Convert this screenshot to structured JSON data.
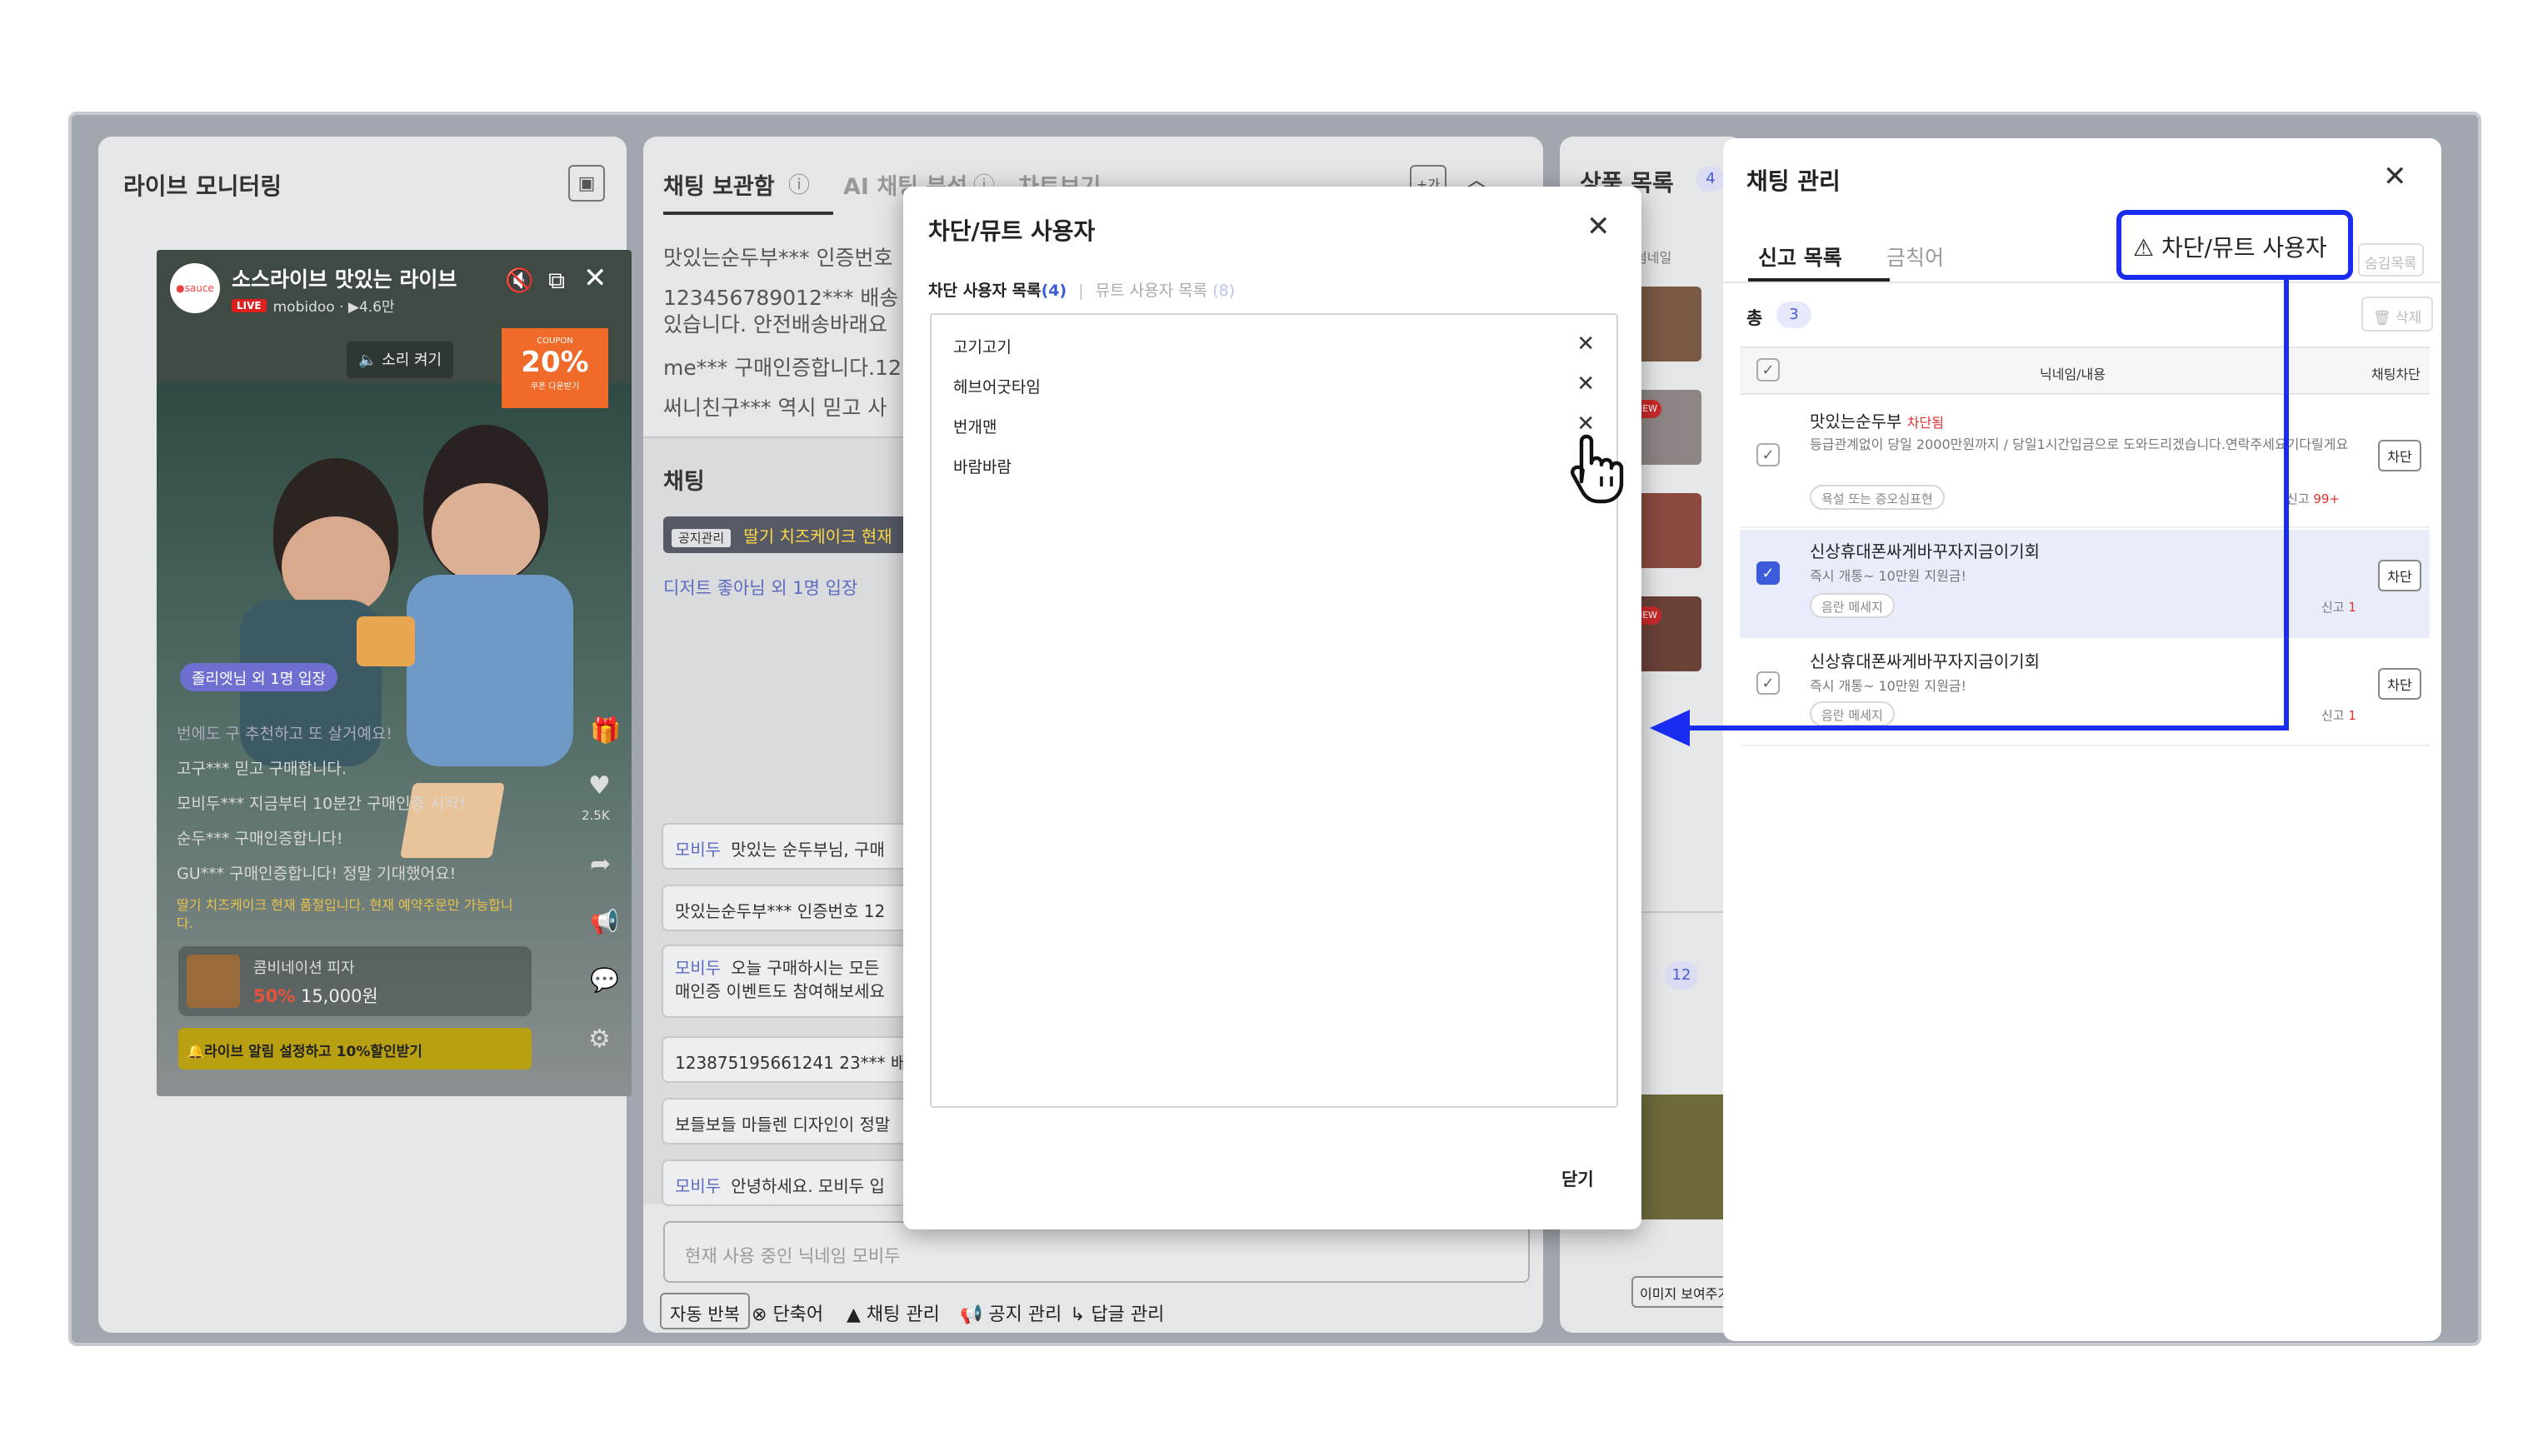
{
  "live_monitor": {
    "title": "라이브 모니터링",
    "stream_title": "소스라이브 맛있는 라이브",
    "live_badge": "LIVE",
    "channel_meta": "mobidoo · ▶4.6만",
    "sound_on_label": "소리 켜기",
    "coupon_top": "COUPON",
    "coupon_value": "20%",
    "coupon_sub": "쿠폰 다운받기",
    "entry_notice": "졸리엣님 외 1명 입장",
    "overlay_lines": [
      "번에도 구 추천하고 또 살거예요!",
      "고구*** 믿고 구매합니다.",
      "모비두*** 지금부터 10분간 구매인증 시작!",
      "순두*** 구매인증합니다!",
      "GU*** 구매인증합니다! 정말 기대했어요!"
    ],
    "notice_line": "딸기 치즈케이크 현재 품절입니다. 현재 예약주문만 가능합니다.",
    "product_name": "콤비네이션 피자",
    "product_discount": "50%",
    "product_price": "15,000원",
    "alarm_button": "라이브 알림 설정하고 10%할인받기",
    "like_count": "2.5K"
  },
  "chat_panel": {
    "tabs": [
      "채팅 보관함",
      "AI 채팅 분석",
      "차트보기"
    ],
    "add_label": "+가",
    "archive_lines": [
      "맛있는순두부*** 인증번호",
      "123456789012*** 배송",
      "있습니다. 안전배송바래요",
      "me*** 구매인증합니다.12",
      "써니친구*** 역시 믿고 사"
    ],
    "section_title": "채팅",
    "notice_badge": "공지관리",
    "notice_text": "딸기 치즈케이크 현재",
    "entry_text": "디저트 좋아님 외 1명 입장",
    "bubbles": [
      {
        "nick": "모비두",
        "text": "맛있는 순두부님, 구매"
      },
      {
        "nick": "",
        "text": "맛있는순두부*** 인증번호 12"
      },
      {
        "nick": "모비두",
        "text": "오늘 구매하시는 모든"
      },
      {
        "nick": "",
        "text": "123875195661241 23*** 배"
      },
      {
        "nick": "",
        "text": "보들보들 마들렌 디자인이 정말"
      },
      {
        "nick": "모비두",
        "text": "안녕하세요. 모비두 입"
      }
    ],
    "bubble3_line2": "매인증 이벤트도 참여해보세요",
    "input_placeholder": "현재 사용 중인 닉네임 모비두",
    "toolbar": [
      "자동 반복",
      "단축어",
      "채팅 관리",
      "공지 관리",
      "답글 관리"
    ]
  },
  "product_panel": {
    "title": "상품 목록",
    "count": "4",
    "thumb_label": "썸네일",
    "count2": "12",
    "show_image": "이미지 보여주기",
    "new_badge": "NEW"
  },
  "modal": {
    "title": "차단/뮤트 사용자",
    "tab_blocked": "차단 사용자 목록",
    "tab_blocked_count": "(4)",
    "tab_muted": "뮤트 사용자 목록",
    "tab_muted_count": "(8)",
    "users": [
      "고기고기",
      "헤브어굿타임",
      "번개맨",
      "바람바람"
    ],
    "close_label": "닫기"
  },
  "chat_manage": {
    "title": "채팅 관리",
    "tabs": [
      "신고 목록",
      "금칙어"
    ],
    "hidden_list_btn": "숨김목록",
    "delete_btn": "삭제",
    "total_label": "총",
    "total_count": "3",
    "col_nickname": "닉네임/내용",
    "col_block": "채팅차단",
    "rows": [
      {
        "nick": "맛있는순두부",
        "status": "차단됨",
        "content": "등급관계없이 당일 2000만원까지 / 당일1시간입금으로 도와드리겠습니다.연락주세요기다릴게요",
        "tag": "욕설 또는 증오심표현",
        "report_label": "신고",
        "report_count": "99+",
        "btn": "차단"
      },
      {
        "nick": "신상휴대폰싸게바꾸자지금이기회",
        "status": "",
        "content": "즉시 개통~ 10만원 지원금!",
        "tag": "음란 메세지",
        "report_label": "신고",
        "report_count": "1",
        "btn": "차단"
      },
      {
        "nick": "신상휴대폰싸게바꾸자지금이기회",
        "status": "",
        "content": "즉시 개통~ 10만원 지원금!",
        "tag": "음란 메세지",
        "report_label": "신고",
        "report_count": "1",
        "btn": "차단"
      }
    ]
  },
  "callout": {
    "label": "차단/뮤트 사용자",
    "color": "#1a2cf0"
  }
}
